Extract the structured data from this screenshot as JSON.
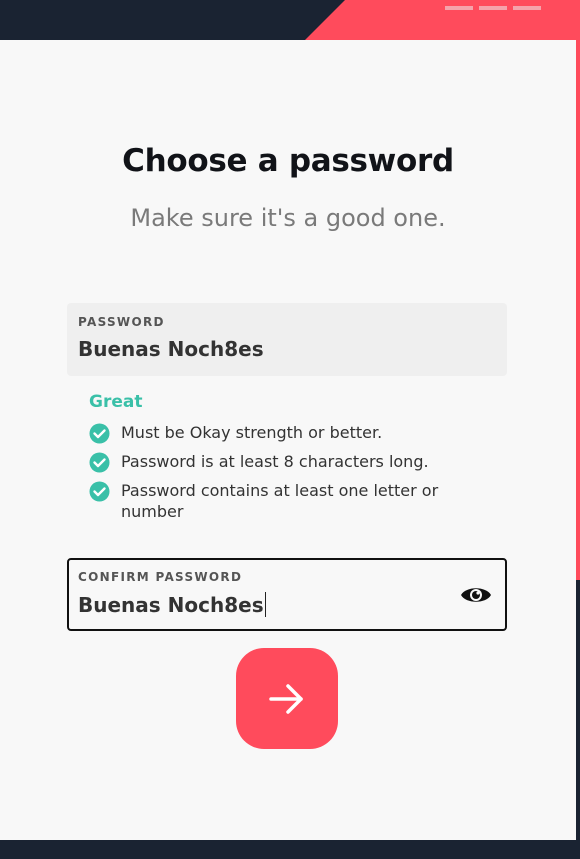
{
  "header": {
    "progress_steps": 3
  },
  "main": {
    "title": "Choose a password",
    "subtitle": "Make sure it's a good one."
  },
  "password_field": {
    "label": "PASSWORD",
    "value": "Buenas Noch8es"
  },
  "strength": {
    "label": "Great"
  },
  "rules": [
    {
      "text": "Must be Okay strength or better.",
      "met": true
    },
    {
      "text": "Password is at least 8 characters long.",
      "met": true
    },
    {
      "text": "Password contains at least one letter or number",
      "met": true
    }
  ],
  "confirm_field": {
    "label": "CONFIRM PASSWORD",
    "value": "Buenas Noch8es",
    "toggle_icon": "eye-icon"
  },
  "submit": {
    "icon": "arrow-right-icon"
  },
  "colors": {
    "accent": "#ff4b5c",
    "success": "#3ac0a8",
    "background": "#1a2332",
    "card": "#f8f8f8"
  }
}
